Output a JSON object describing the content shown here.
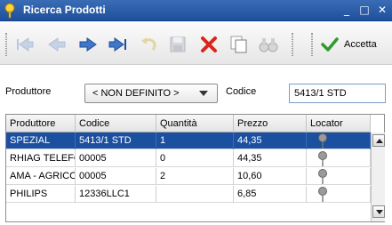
{
  "window": {
    "title": "Ricerca Prodotti",
    "controls": {
      "minimize": "_",
      "maximize": "□",
      "close": "✕"
    },
    "title_bar_color": "#2a5aa8"
  },
  "toolbar": {
    "buttons": [
      {
        "name": "first-record",
        "icon": "first-arrow-icon",
        "enabled": false
      },
      {
        "name": "previous-record",
        "icon": "left-arrow-icon",
        "enabled": false
      },
      {
        "name": "next-record",
        "icon": "right-arrow-icon",
        "enabled": true
      },
      {
        "name": "last-record",
        "icon": "last-arrow-icon",
        "enabled": true
      },
      {
        "name": "undo",
        "icon": "undo-icon",
        "enabled": false
      },
      {
        "name": "save",
        "icon": "save-icon",
        "enabled": false
      },
      {
        "name": "delete",
        "icon": "delete-x-icon",
        "enabled": true
      },
      {
        "name": "copy",
        "icon": "copy-icon",
        "enabled": true
      },
      {
        "name": "search",
        "icon": "binoculars-icon",
        "enabled": false
      }
    ],
    "accept_label": "Accetta"
  },
  "filters": {
    "producer_label": "Produttore",
    "producer_value": "< NON DEFINITO >",
    "code_label": "Codice",
    "code_value": "5413/1 STD"
  },
  "table": {
    "columns": [
      "Produttore",
      "Codice",
      "Quantità",
      "Prezzo",
      "Locator"
    ],
    "rows": [
      {
        "produttore": "SPEZIAL",
        "codice": "5413/1 STD",
        "quantita": "1",
        "prezzo": "44,35",
        "selected": true
      },
      {
        "produttore": "RHIAG TELEFONO",
        "codice": "00005",
        "quantita": "0",
        "prezzo": "44,35",
        "selected": false
      },
      {
        "produttore": "AMA - AGRICOLA",
        "codice": "00005",
        "quantita": "2",
        "prezzo": "10,60",
        "selected": false
      },
      {
        "produttore": "PHILIPS",
        "codice": "12336LLC1",
        "quantita": "",
        "prezzo": "6,85",
        "selected": false
      }
    ],
    "selection_color": "#1b4fa0"
  }
}
